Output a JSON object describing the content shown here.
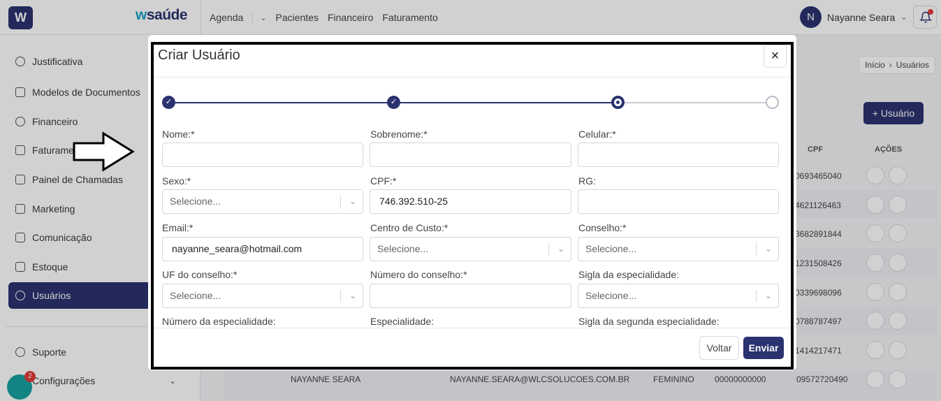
{
  "app": {
    "logo_letter": "W",
    "brand_w": "w",
    "brand_rest": "saúde"
  },
  "topnav": {
    "items": [
      "Agenda",
      "Pacientes",
      "Financeiro",
      "Faturamento"
    ]
  },
  "user": {
    "initial": "N",
    "name": "Nayanne Seara"
  },
  "sidebar": {
    "items": [
      {
        "label": "Justificativa"
      },
      {
        "label": "Modelos de Documentos"
      },
      {
        "label": "Financeiro"
      },
      {
        "label": "Faturamento"
      },
      {
        "label": "Painel de Chamadas"
      },
      {
        "label": "Marketing"
      },
      {
        "label": "Comunicação"
      },
      {
        "label": "Estoque"
      },
      {
        "label": "Usuários"
      },
      {
        "label": "Suporte"
      },
      {
        "label": "Configurações"
      }
    ],
    "chat_badge": "2"
  },
  "breadcrumb": {
    "home": "Início",
    "current": "Usuários"
  },
  "page": {
    "add_user_label": "+ Usuário",
    "columns": {
      "cpf": "CPF",
      "actions": "AÇÕES"
    },
    "cpf_values": [
      "0693465040",
      "4621126463",
      "3682891844",
      "1231508426",
      "0339698096",
      "0788787497",
      "1414217471"
    ],
    "last_row": {
      "name": "NAYANNE SEARA",
      "email": "NAYANNE.SEARA@WLCSOLUCOES.COM.BR",
      "sex": "FEMININO",
      "rg": "00000000000",
      "cpf": "09572720490"
    }
  },
  "modal": {
    "title": "Criar Usuário",
    "close": "×",
    "fields": {
      "nome": {
        "label": "Nome:*",
        "value": ""
      },
      "sobrenome": {
        "label": "Sobrenome:*",
        "value": ""
      },
      "celular": {
        "label": "Celular:*",
        "value": ""
      },
      "sexo": {
        "label": "Sexo:*",
        "placeholder": "Selecione..."
      },
      "cpf": {
        "label": "CPF:*",
        "value": "746.392.510-25"
      },
      "rg": {
        "label": "RG:",
        "value": ""
      },
      "email": {
        "label": "Email:*",
        "value": "nayanne_seara@hotmail.com"
      },
      "centro": {
        "label": "Centro de Custo:*",
        "placeholder": "Selecione..."
      },
      "conselho": {
        "label": "Conselho:*",
        "placeholder": "Selecione..."
      },
      "uf": {
        "label": "UF do conselho:*",
        "placeholder": "Selecione..."
      },
      "numero_conselho": {
        "label": "Número do conselho:*",
        "value": ""
      },
      "sigla": {
        "label": "Sigla da especialidade:",
        "placeholder": "Selecione..."
      },
      "numero_esp": {
        "label": "Número da especialidade:"
      },
      "especialidade": {
        "label": "Especialidade:"
      },
      "sigla2": {
        "label": "Sigla da segunda especialidade:"
      }
    },
    "buttons": {
      "back": "Voltar",
      "send": "Enviar"
    },
    "stepper": {
      "total": 4,
      "current": 3
    }
  },
  "colors": {
    "primary": "#2b3270",
    "accent": "#1aa3c2"
  }
}
